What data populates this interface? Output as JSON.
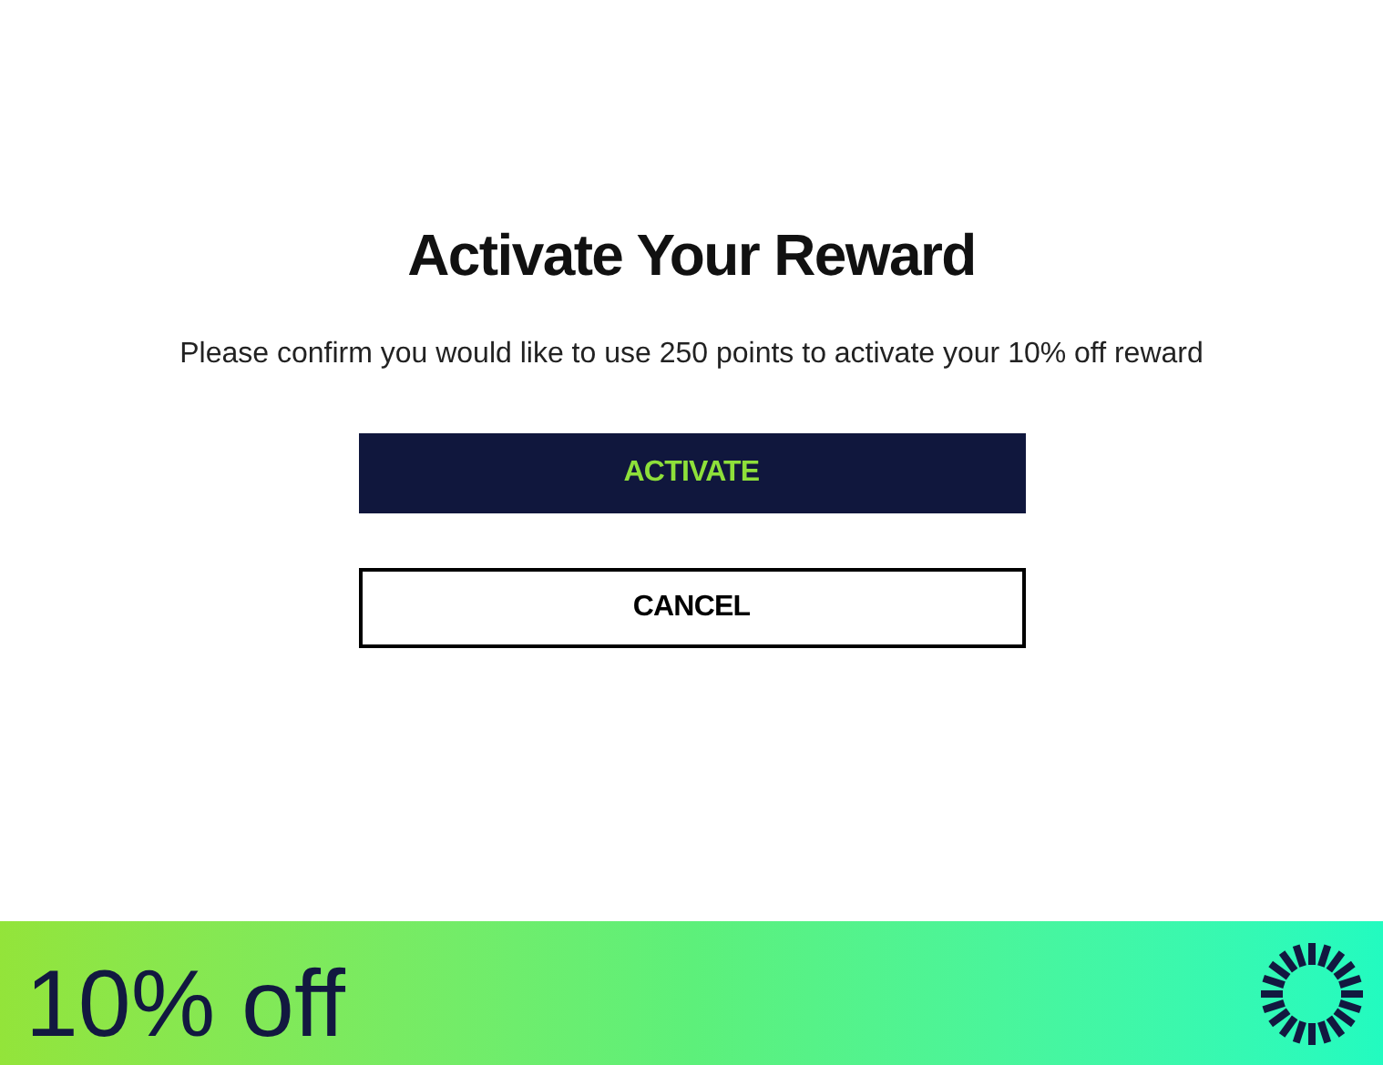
{
  "dialog": {
    "title": "Activate Your Reward",
    "message": "Please confirm you would like to use 250 points to activate your 10% off reward",
    "buttons": [
      {
        "kind": "primary",
        "label": "ACTIVATE"
      },
      {
        "kind": "secondary",
        "label": "CANCEL"
      }
    ]
  },
  "banner": {
    "text": "10% off"
  }
}
